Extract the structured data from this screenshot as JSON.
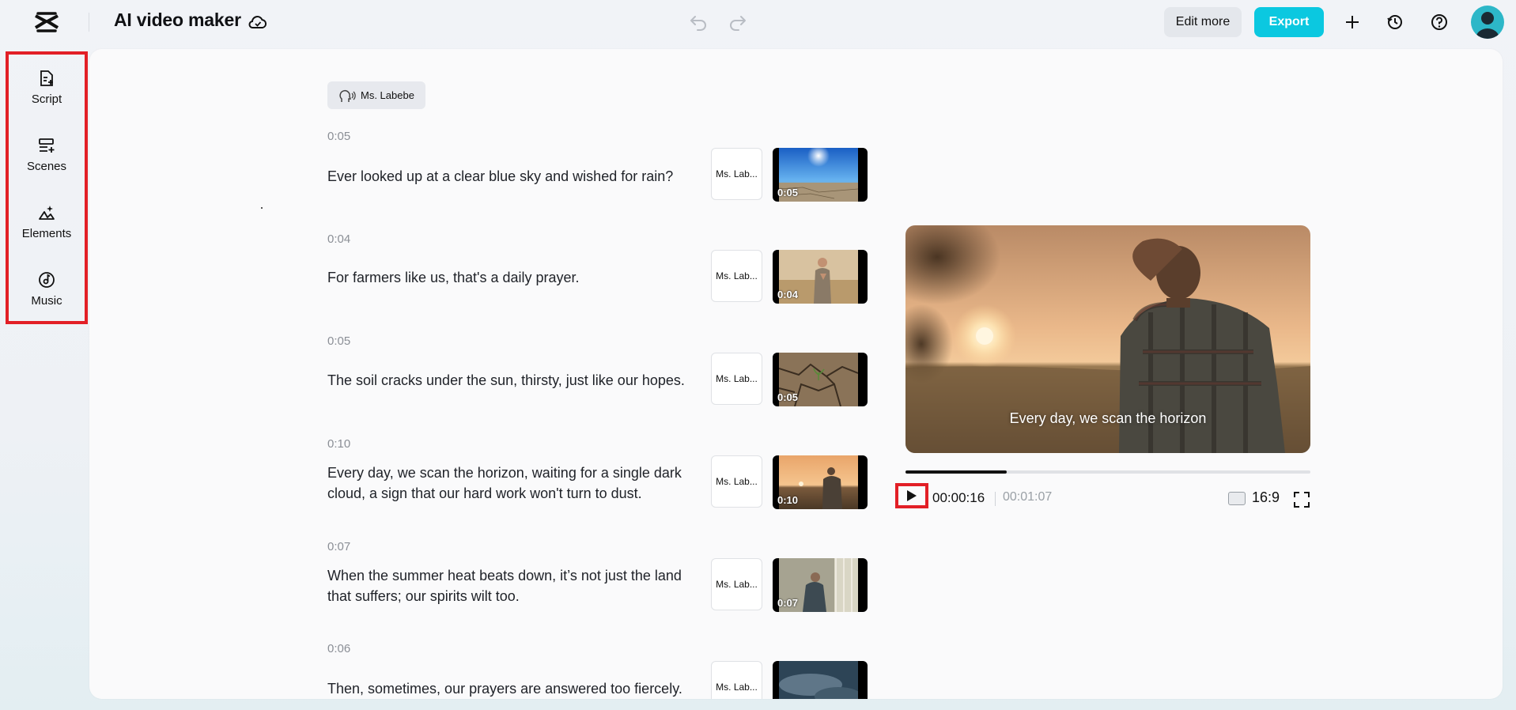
{
  "app": {
    "title": "AI video maker"
  },
  "toolbar": {
    "edit_more": "Edit more",
    "export": "Export"
  },
  "sidebar": {
    "items": [
      {
        "label": "Script",
        "icon": "script-icon"
      },
      {
        "label": "Scenes",
        "icon": "scenes-icon"
      },
      {
        "label": "Elements",
        "icon": "elements-icon"
      },
      {
        "label": "Music",
        "icon": "music-icon"
      }
    ]
  },
  "voice": {
    "name": "Ms. Labebe",
    "short": "Ms. Lab..."
  },
  "scenes": [
    {
      "time": "0:05",
      "text": "Ever looked up at a clear blue sky and wished for rain?",
      "duration": "0:05"
    },
    {
      "time": "0:04",
      "text": "For farmers like us, that's a daily prayer.",
      "duration": "0:04"
    },
    {
      "time": "0:05",
      "text": "The soil cracks under the sun, thirsty, just like our hopes.",
      "duration": "0:05"
    },
    {
      "time": "0:10",
      "text": "Every day, we scan the horizon, waiting for a single dark cloud, a sign that our hard work won't turn to dust.",
      "duration": "0:10"
    },
    {
      "time": "0:07",
      "text": "When the summer heat beats down, it’s not just the land that suffers; our spirits wilt too.",
      "duration": "0:07"
    },
    {
      "time": "0:06",
      "text": "Then, sometimes, our prayers are answered too fiercely.",
      "duration": ""
    }
  ],
  "player": {
    "caption": "Every day, we scan the horizon",
    "current_time": "00:00:16",
    "total_time": "00:01:07",
    "progress_fraction": 0.25,
    "aspect_ratio": "16:9"
  },
  "colors": {
    "accent": "#0bc8e0",
    "highlight": "#e21f26"
  }
}
